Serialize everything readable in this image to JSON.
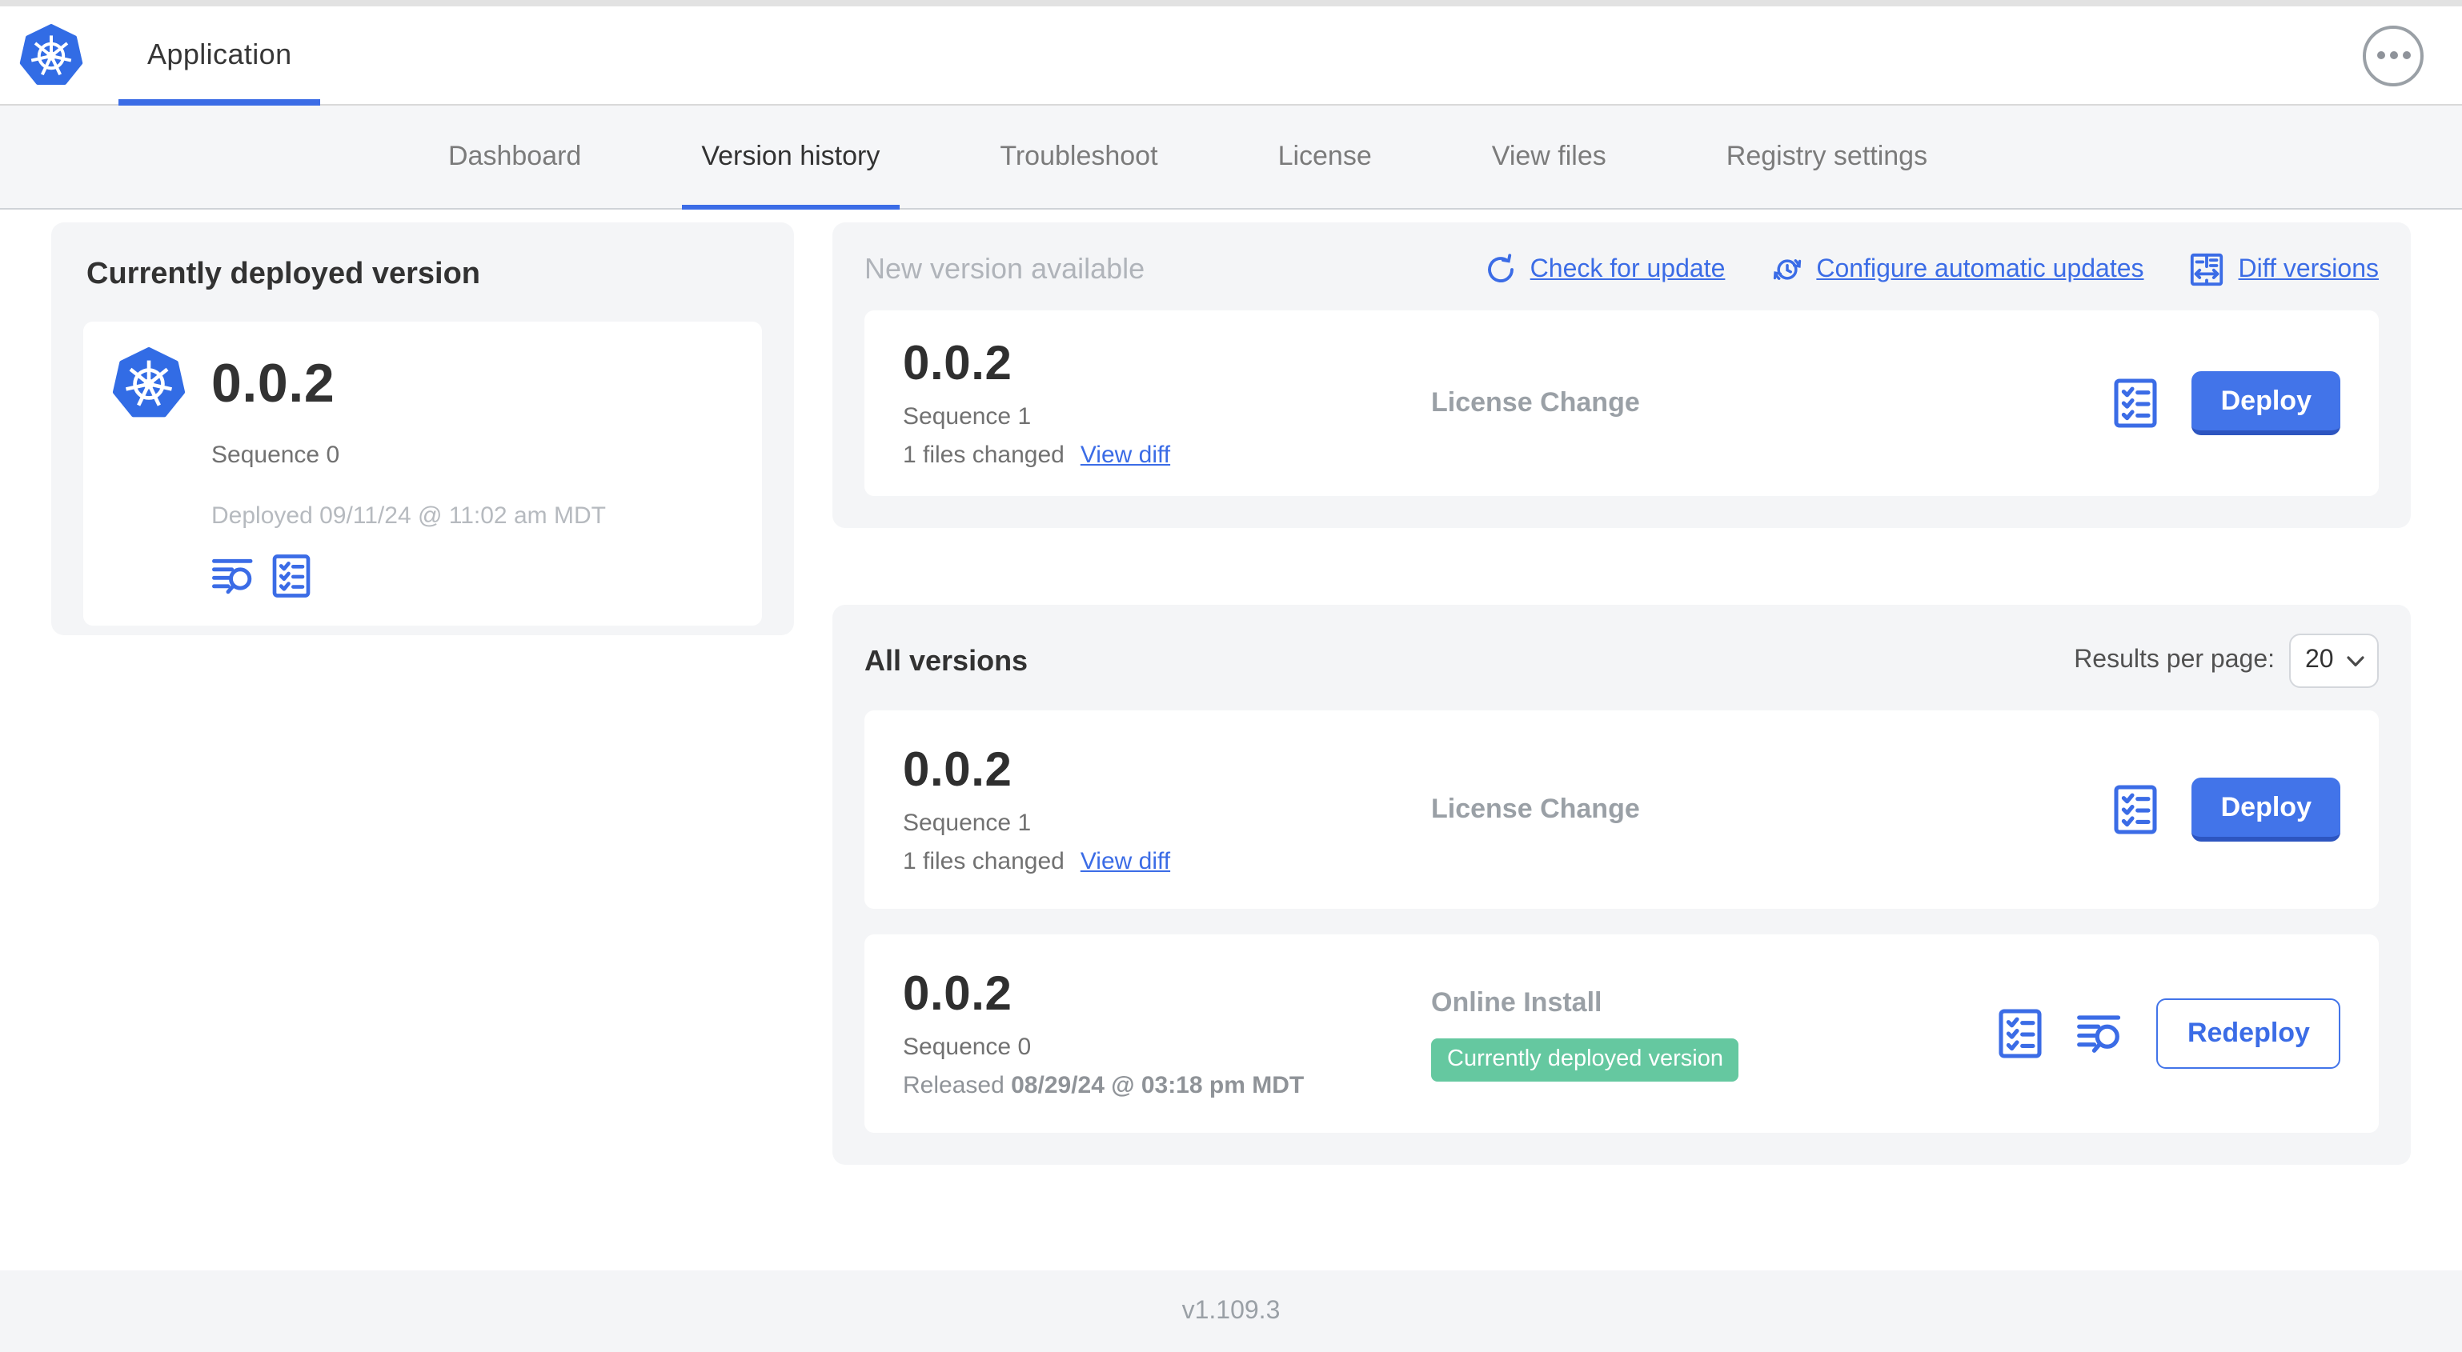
{
  "header": {
    "app_tab_label": "Application",
    "more_options_icon": "ellipsis-icon"
  },
  "nav": {
    "active_tab": "Version history",
    "tabs": [
      {
        "label": "Dashboard"
      },
      {
        "label": "Version history"
      },
      {
        "label": "Troubleshoot"
      },
      {
        "label": "License"
      },
      {
        "label": "View files"
      },
      {
        "label": "Registry settings"
      }
    ]
  },
  "current_version": {
    "title": "Currently deployed version",
    "version": "0.0.2",
    "sequence": "Sequence 0",
    "deployed": "Deployed 09/11/24 @ 11:02 am MDT",
    "icons": [
      "logs-icon",
      "checklist-icon"
    ]
  },
  "new_version": {
    "title": "New version available",
    "actions": [
      {
        "label": "Check for update",
        "icon": "refresh-icon"
      },
      {
        "label": "Configure automatic updates",
        "icon": "auto-update-icon"
      },
      {
        "label": "Diff versions",
        "icon": "diff-icon"
      }
    ],
    "card": {
      "version": "0.0.2",
      "sequence": "Sequence 1",
      "files_changed": "1 files changed",
      "view_diff": "View diff",
      "source": "License Change",
      "deploy": "Deploy",
      "icons": [
        "checklist-icon"
      ]
    }
  },
  "all_versions": {
    "title": "All versions",
    "results_per_page_label": "Results per page:",
    "results_per_page_value": "20",
    "rows": [
      {
        "version": "0.0.2",
        "sequence": "Sequence 1",
        "files_changed": "1 files changed",
        "view_diff": "View diff",
        "source": "License Change",
        "action": "Deploy",
        "icons": [
          "checklist-icon"
        ]
      },
      {
        "version": "0.0.2",
        "sequence": "Sequence 0",
        "released_prefix": "Released",
        "released_date": "08/29/24 @ 03:18 pm MDT",
        "source": "Online Install",
        "badge": "Currently deployed version",
        "action": "Redeploy",
        "icons": [
          "checklist-icon",
          "logs-icon"
        ]
      }
    ]
  },
  "footer": {
    "version": "v1.109.3"
  },
  "colors": {
    "accent_blue": "#3b6ce6",
    "button_blue": "#4274e9",
    "button_blue_shade": "#2d55c0",
    "badge_green": "#65c8a0",
    "panel_gray": "#f4f5f7",
    "text_dark": "#323232",
    "text_gray": "#717171",
    "text_muted": "#9aa0a6",
    "kubernetes_blue": "#326ce5"
  }
}
